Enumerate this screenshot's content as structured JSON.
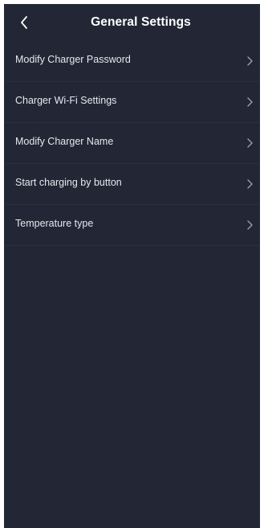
{
  "header": {
    "title": "General Settings",
    "back_icon": "chevron-left-icon"
  },
  "settings": {
    "items": [
      {
        "label": "Modify Charger Password",
        "icon": "chevron-right-icon"
      },
      {
        "label": "Charger Wi-Fi Settings",
        "icon": "chevron-right-icon"
      },
      {
        "label": "Modify Charger Name",
        "icon": "chevron-right-icon"
      },
      {
        "label": "Start charging by button",
        "icon": "chevron-right-icon"
      },
      {
        "label": "Temperature type",
        "icon": "chevron-right-icon"
      }
    ]
  },
  "colors": {
    "background": "#232634",
    "text": "#e6e8ef",
    "chevron": "#9aa0ae"
  }
}
